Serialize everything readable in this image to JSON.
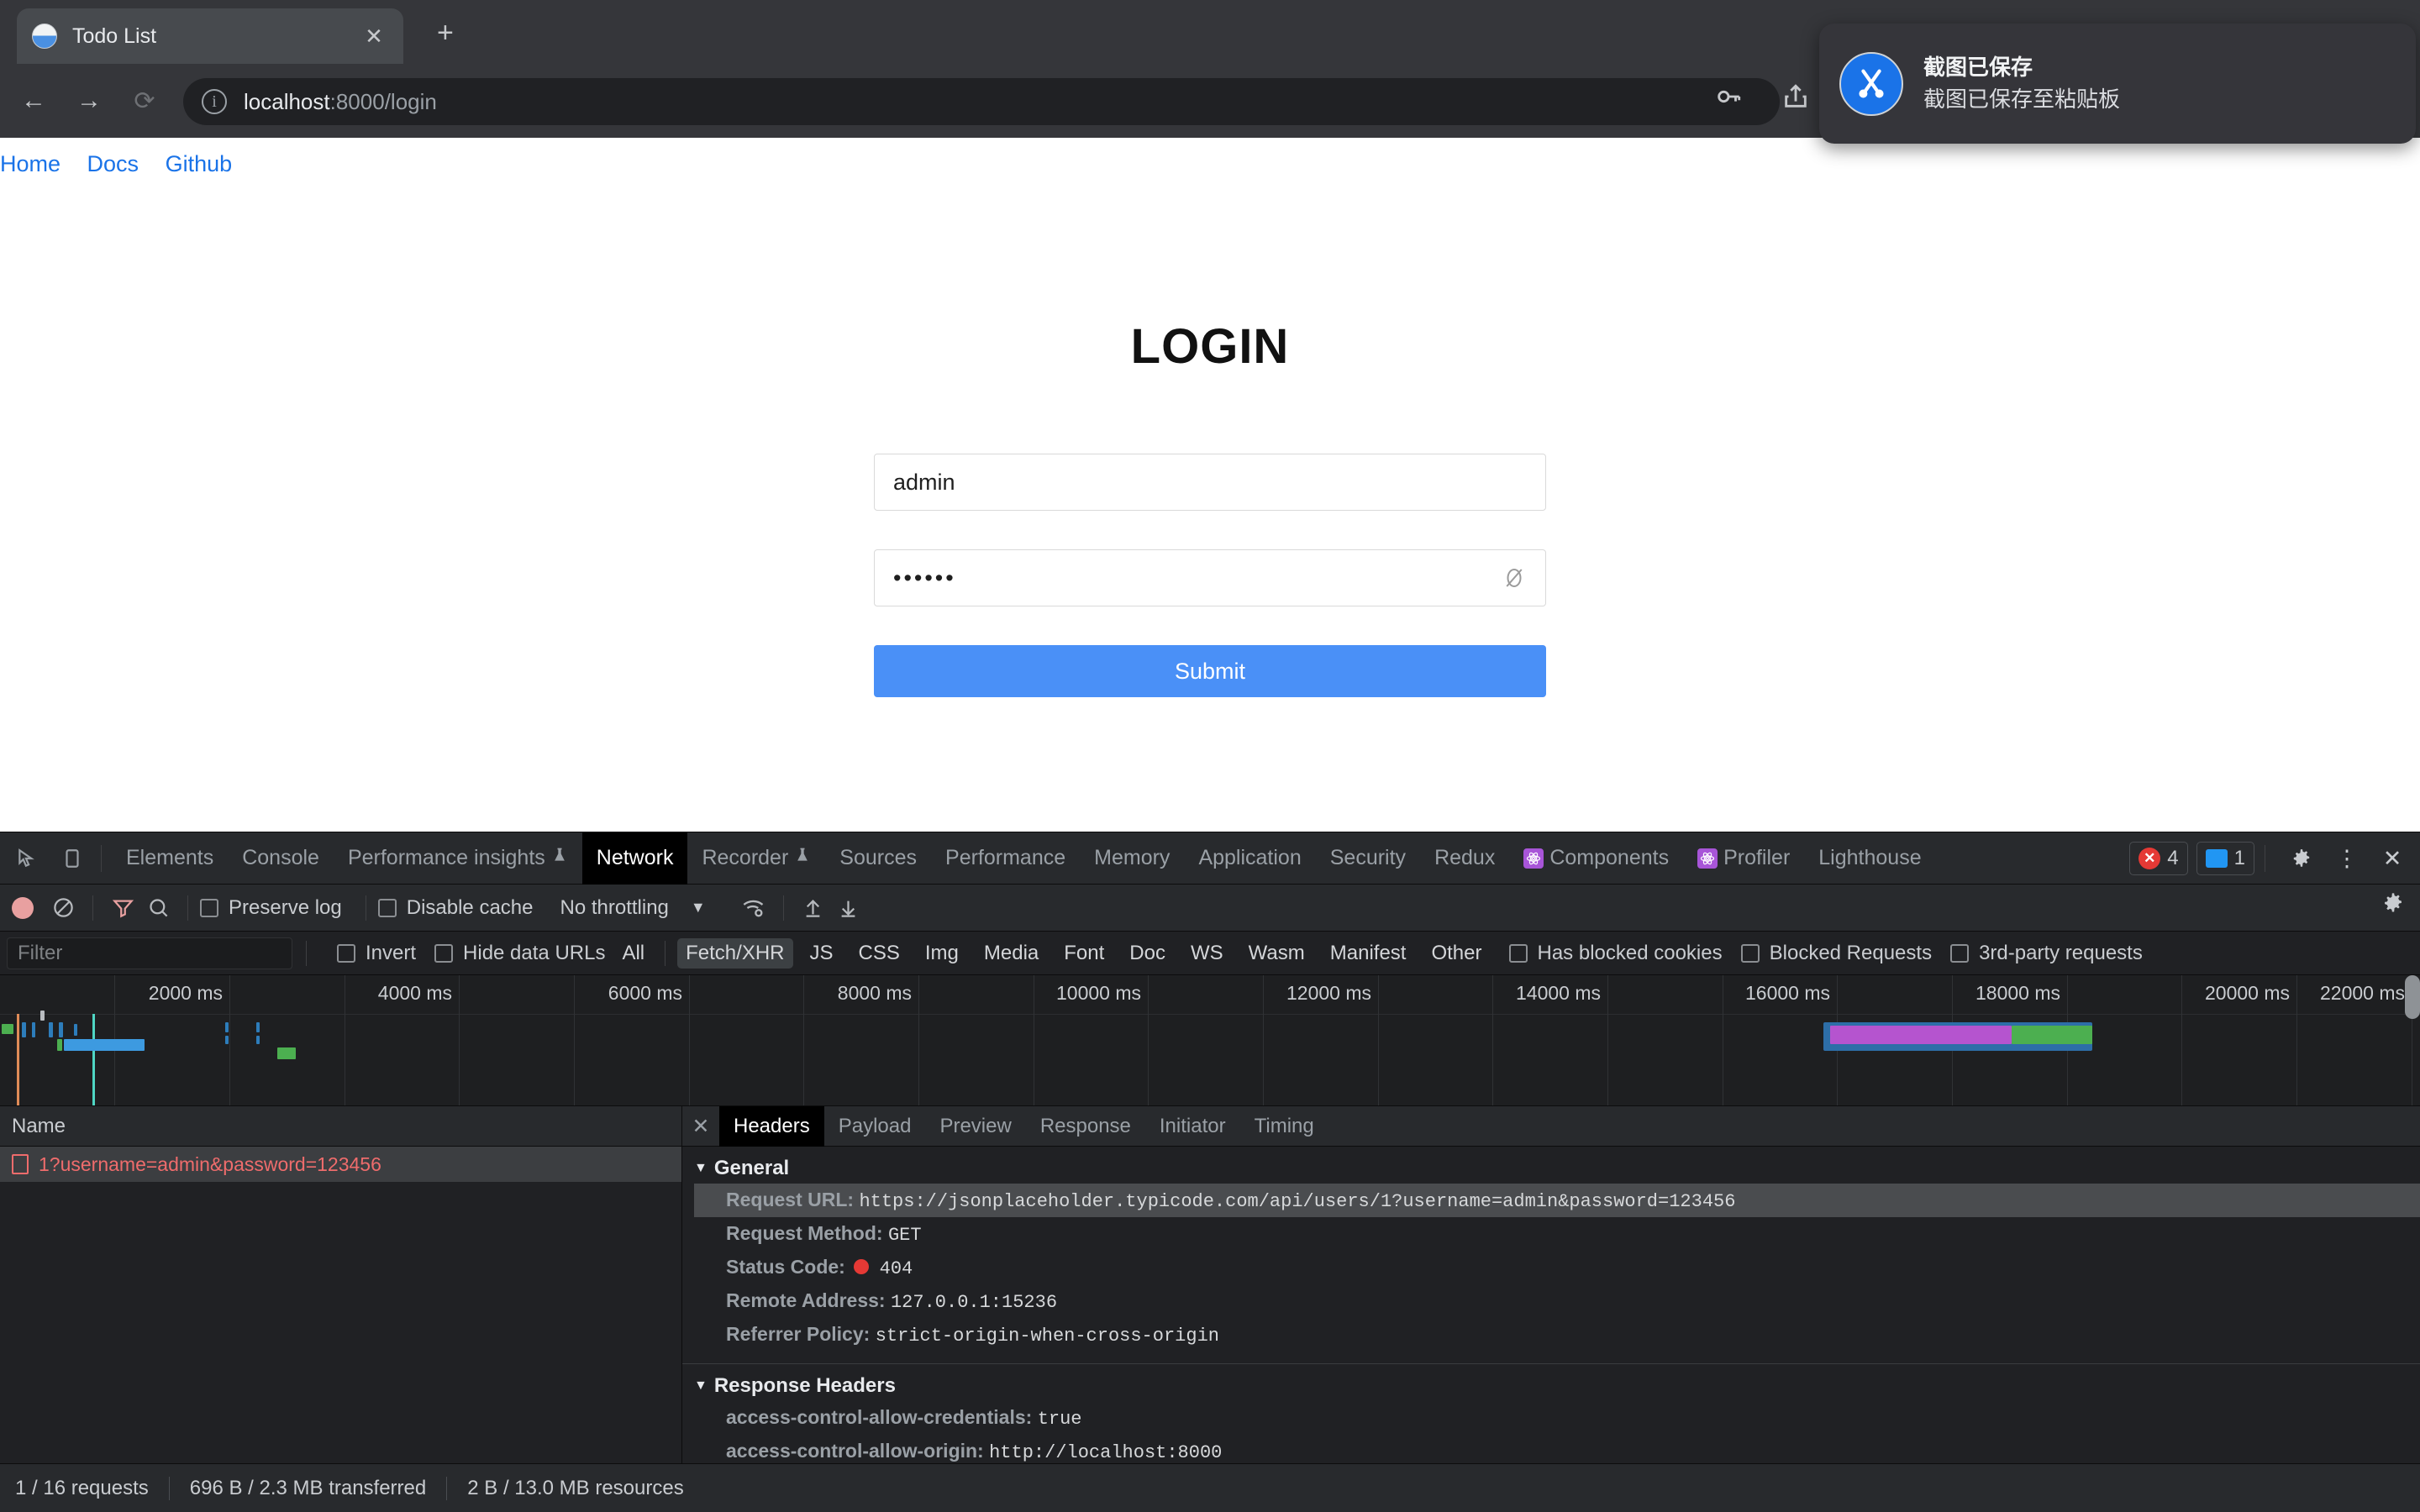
{
  "browser": {
    "tab": {
      "title": "Todo List",
      "favicon": "globe-icon",
      "close_label": "✕"
    },
    "new_tab_label": "+",
    "nav": {
      "back": "←",
      "forward": "→",
      "reload": "⟳"
    },
    "omnibox": {
      "info_icon": "ⓘ",
      "url_host": "localhost",
      "url_rest": ":8000/login"
    },
    "toolbar_icons": [
      "key-icon",
      "share-icon"
    ]
  },
  "toast": {
    "icon": "scissors-icon",
    "title": "截图已保存",
    "subtitle": "截图已保存至粘贴板"
  },
  "page": {
    "nav_links": [
      "Home",
      "Docs",
      "Github"
    ],
    "title": "LOGIN",
    "username": {
      "value": "admin",
      "placeholder": ""
    },
    "password": {
      "value": "••••••",
      "placeholder": "",
      "toggle_icon": "eye-off-icon"
    },
    "submit_label": "Submit"
  },
  "devtools": {
    "tabs": [
      {
        "label": "Elements",
        "active": false,
        "badge": null
      },
      {
        "label": "Console",
        "active": false,
        "badge": null
      },
      {
        "label": "Performance insights",
        "active": false,
        "badge": "flask-icon"
      },
      {
        "label": "Network",
        "active": true,
        "badge": null
      },
      {
        "label": "Recorder",
        "active": false,
        "badge": "flask-icon"
      },
      {
        "label": "Sources",
        "active": false,
        "badge": null
      },
      {
        "label": "Performance",
        "active": false,
        "badge": null
      },
      {
        "label": "Memory",
        "active": false,
        "badge": null
      },
      {
        "label": "Application",
        "active": false,
        "badge": null
      },
      {
        "label": "Security",
        "active": false,
        "badge": null
      },
      {
        "label": "Redux",
        "active": false,
        "badge": null
      },
      {
        "label": "Components",
        "active": false,
        "badge": "react-icon"
      },
      {
        "label": "Profiler",
        "active": false,
        "badge": "react-icon"
      },
      {
        "label": "Lighthouse",
        "active": false,
        "badge": null
      }
    ],
    "counters": {
      "errors": "4",
      "messages": "1"
    },
    "right_icons": [
      "gear-icon",
      "kebab-menu-icon",
      "close-icon"
    ],
    "network_toolbar": {
      "record_icon": "record-icon",
      "clear_icon": "clear-icon",
      "filter_icon": "funnel-icon",
      "search_icon": "search-icon",
      "preserve_log_label": "Preserve log",
      "preserve_log_checked": false,
      "disable_cache_label": "Disable cache",
      "disable_cache_checked": false,
      "throttling_value": "No throttling",
      "wifi_icon": "wifi-settings-icon",
      "import_icon": "upload-icon",
      "export_icon": "download-icon",
      "settings_icon": "gear-icon"
    },
    "filter_bar": {
      "filter_placeholder": "Filter",
      "invert_label": "Invert",
      "invert_checked": false,
      "hide_data_urls_label": "Hide data URLs",
      "hide_data_urls_checked": false,
      "types": [
        "All",
        "Fetch/XHR",
        "JS",
        "CSS",
        "Img",
        "Media",
        "Font",
        "Doc",
        "WS",
        "Wasm",
        "Manifest",
        "Other"
      ],
      "active_type": "Fetch/XHR",
      "has_blocked_cookies_label": "Has blocked cookies",
      "has_blocked_cookies_checked": false,
      "blocked_requests_label": "Blocked Requests",
      "blocked_requests_checked": false,
      "third_party_label": "3rd-party requests",
      "third_party_checked": false
    },
    "overview": {
      "ticks": [
        "2000 ms",
        "4000 ms",
        "6000 ms",
        "8000 ms",
        "10000 ms",
        "12000 ms",
        "14000 ms",
        "16000 ms",
        "18000 ms",
        "20000 ms",
        "22000 ms"
      ]
    },
    "requests": {
      "column_header": "Name",
      "rows": [
        {
          "name": "1?username=admin&password=123456",
          "status": "error"
        }
      ]
    },
    "detail_tabs": [
      "Headers",
      "Payload",
      "Preview",
      "Response",
      "Initiator",
      "Timing"
    ],
    "detail_active_tab": "Headers",
    "headers": {
      "general_title": "General",
      "general": [
        {
          "key": "Request URL:",
          "value": "https://jsonplaceholder.typicode.com/api/users/1?username=admin&password=123456",
          "highlight": true
        },
        {
          "key": "Request Method:",
          "value": "GET",
          "highlight": false
        },
        {
          "key": "Status Code:",
          "value": "404",
          "highlight": false,
          "status_dot": true
        },
        {
          "key": "Remote Address:",
          "value": "127.0.0.1:15236",
          "highlight": false
        },
        {
          "key": "Referrer Policy:",
          "value": "strict-origin-when-cross-origin",
          "highlight": false
        }
      ],
      "response_title": "Response Headers",
      "response": [
        {
          "key": "access-control-allow-credentials:",
          "value": "true"
        },
        {
          "key": "access-control-allow-origin:",
          "value": "http://localhost:8000"
        }
      ]
    },
    "statusbar": [
      "1 / 16 requests",
      "696 B / 2.3 MB transferred",
      "2 B / 13.0 MB resources"
    ]
  },
  "colors": {
    "accent_blue": "#4a90f7",
    "link_blue": "#1a73e8",
    "error_red": "#ef6c6c",
    "devtools_bg": "#202124",
    "devtools_panel": "#282a2d"
  }
}
